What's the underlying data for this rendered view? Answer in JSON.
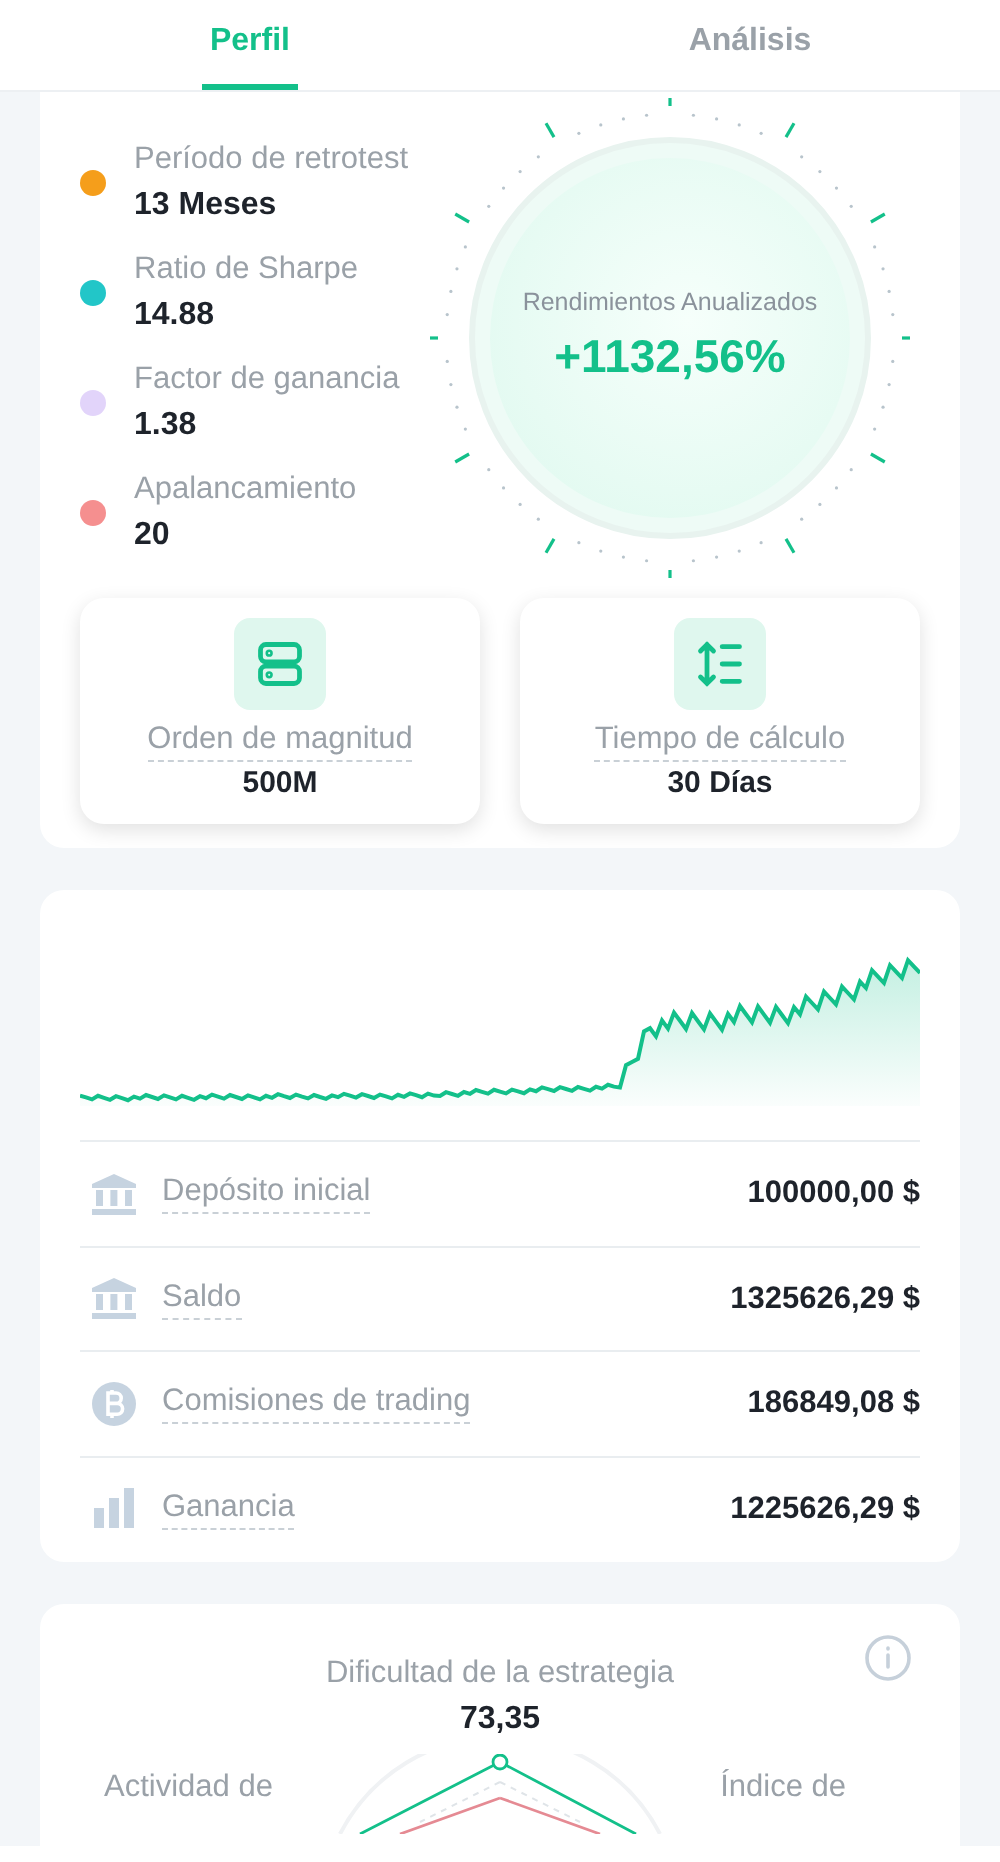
{
  "tabs": [
    {
      "label": "Perfil",
      "selected": true
    },
    {
      "label": "Análisis",
      "selected": false
    }
  ],
  "stats": [
    {
      "label": "Período de retrotest",
      "value": "13 Meses",
      "color": "#f59e1b"
    },
    {
      "label": "Ratio de Sharpe",
      "value": "14.88",
      "color": "#22c6c8"
    },
    {
      "label": "Factor de ganancia",
      "value": "1.38",
      "color": "#e2d4fa"
    },
    {
      "label": "Apalancamiento",
      "value": "20",
      "color": "#f58f8f"
    }
  ],
  "gauge": {
    "label": "Rendimientos Anualizados",
    "value": "+1132,56%"
  },
  "metrics": [
    {
      "label": "Orden de magnitud",
      "value": "500M"
    },
    {
      "label": "Tiempo de cálculo",
      "value": "30 Días"
    }
  ],
  "balances": [
    {
      "label": "Depósito inicial",
      "value": "100000,00 $"
    },
    {
      "label": "Saldo",
      "value": "1325626,29 $"
    },
    {
      "label": "Comisiones de trading",
      "value": "186849,08 $"
    },
    {
      "label": "Ganancia",
      "value": "1225626,29 $"
    }
  ],
  "difficulty": {
    "title": "Dificultad de la estrategia",
    "value": "73,35",
    "left_axis": "Actividad de",
    "right_axis": "Índice de"
  }
}
